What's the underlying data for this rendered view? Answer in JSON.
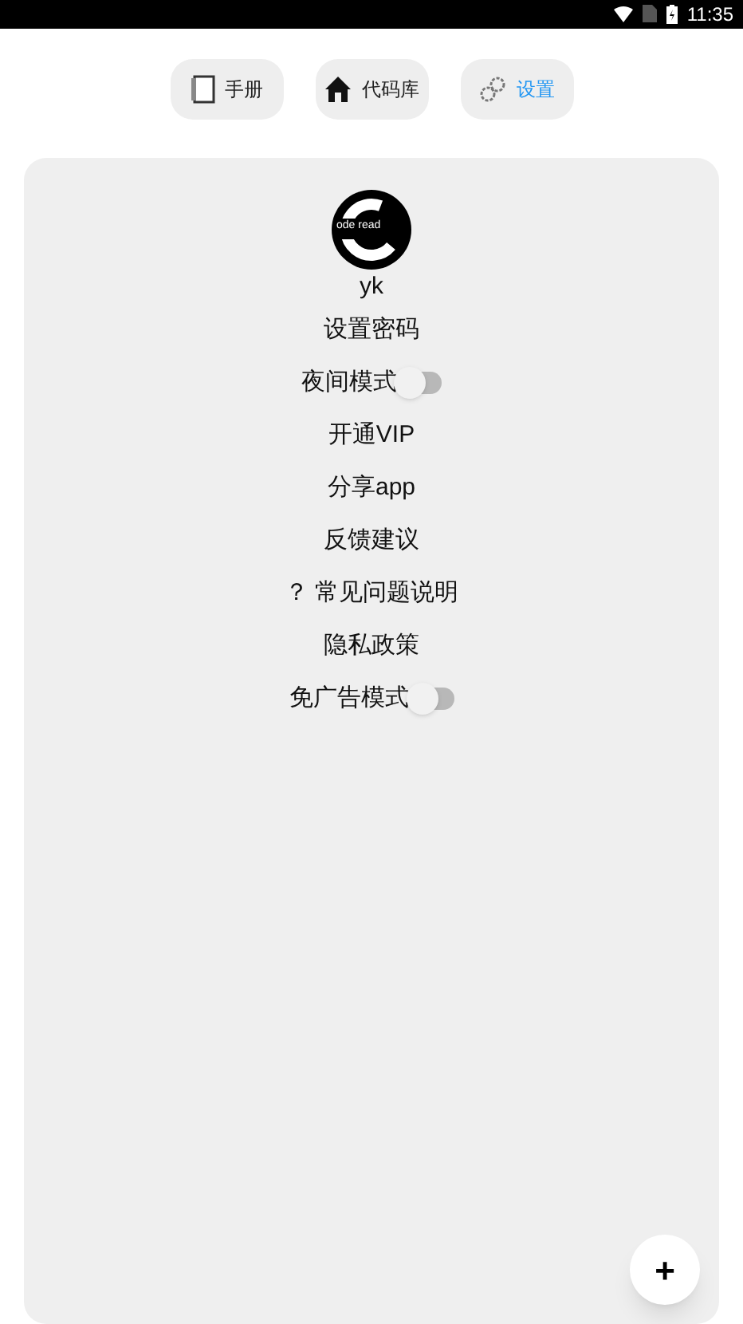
{
  "status_bar": {
    "time": "11:35"
  },
  "tabs": [
    {
      "label": "手册",
      "kind": "book",
      "selected": false
    },
    {
      "label": "代码库",
      "kind": "house",
      "selected": false
    },
    {
      "label": "设置",
      "kind": "gears",
      "selected": true
    }
  ],
  "profile": {
    "logo_text": "ode read",
    "name": "yk"
  },
  "menu": [
    {
      "kind": "link",
      "label": "设置密码"
    },
    {
      "kind": "toggle",
      "label": "夜间模式",
      "on": false
    },
    {
      "kind": "link",
      "label": "开通VIP"
    },
    {
      "kind": "link",
      "label": "分享app"
    },
    {
      "kind": "link",
      "label": "反馈建议"
    },
    {
      "kind": "link",
      "label": "？ 常见问题说明"
    },
    {
      "kind": "link",
      "label": "隐私政策"
    },
    {
      "kind": "toggle",
      "label": "免广告模式",
      "on": false
    }
  ],
  "fab": {
    "label": "+"
  }
}
